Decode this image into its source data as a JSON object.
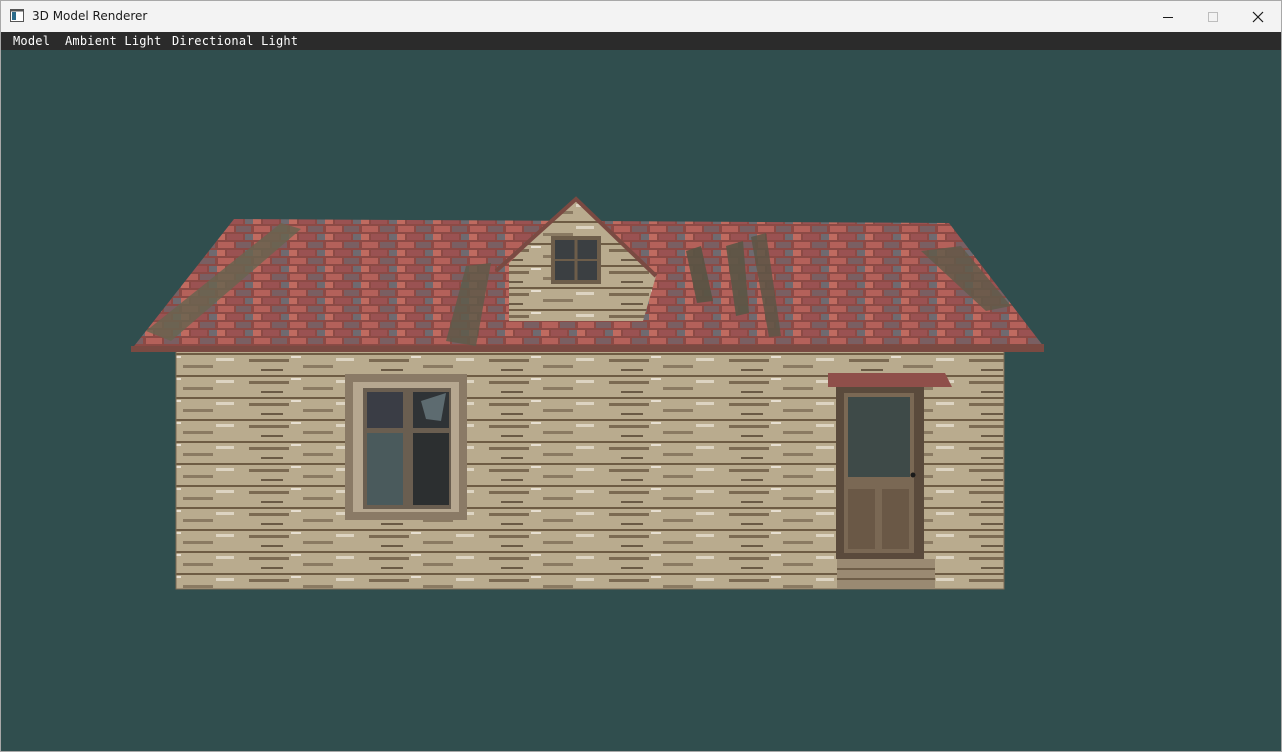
{
  "window": {
    "title": "3D Model Renderer",
    "controls": [
      "minimize",
      "maximize",
      "close"
    ]
  },
  "menubar": {
    "items": [
      {
        "label": "Model"
      },
      {
        "label": "Ambient Light"
      },
      {
        "label": "Directional Light"
      }
    ]
  },
  "viewport": {
    "background": "#304e4e",
    "model": "house"
  },
  "icons": {
    "app": "app-window-icon",
    "minimize": "minimize-icon",
    "maximize": "maximize-icon",
    "close": "close-icon"
  }
}
